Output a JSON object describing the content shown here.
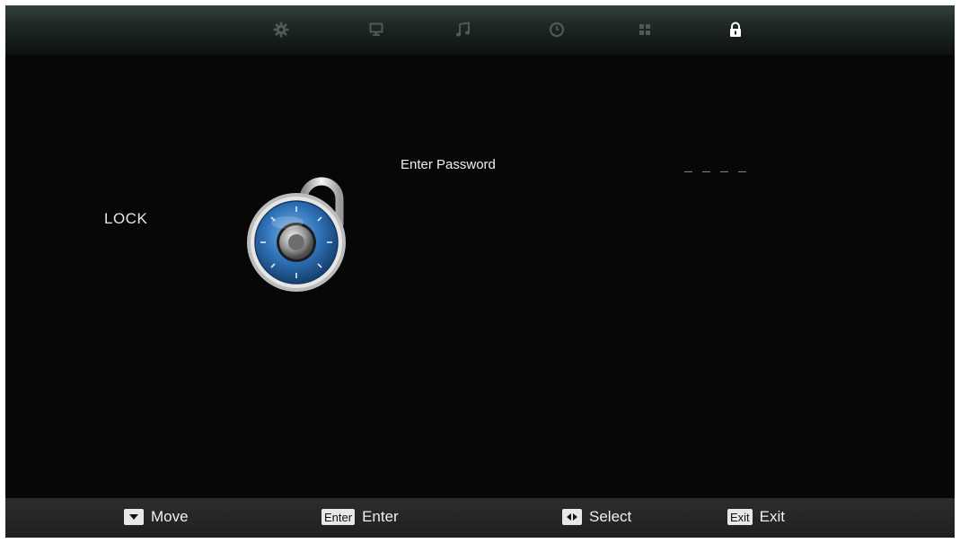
{
  "menu": {
    "tabs": [
      {
        "icon": "gear-icon",
        "active": false
      },
      {
        "icon": "monitor-icon",
        "active": false
      },
      {
        "icon": "music-note-icon",
        "active": false
      },
      {
        "icon": "clock-icon",
        "active": false
      },
      {
        "icon": "grid-icon",
        "active": false
      },
      {
        "icon": "lock-icon",
        "active": true
      }
    ]
  },
  "lock_page": {
    "title": "LOCK",
    "prompt": "Enter Password",
    "password_value": "_ _ _ _"
  },
  "footer": {
    "move": {
      "key": "",
      "label": "Move"
    },
    "enter": {
      "key": "Enter",
      "label": "Enter"
    },
    "select": {
      "key": "",
      "label": "Select"
    },
    "exit": {
      "key": "Exit",
      "label": "Exit"
    }
  },
  "colors": {
    "background": "#070707",
    "topbar": "#24302a",
    "text": "#f0f0f0",
    "lock_blue": "#2f73b8"
  }
}
